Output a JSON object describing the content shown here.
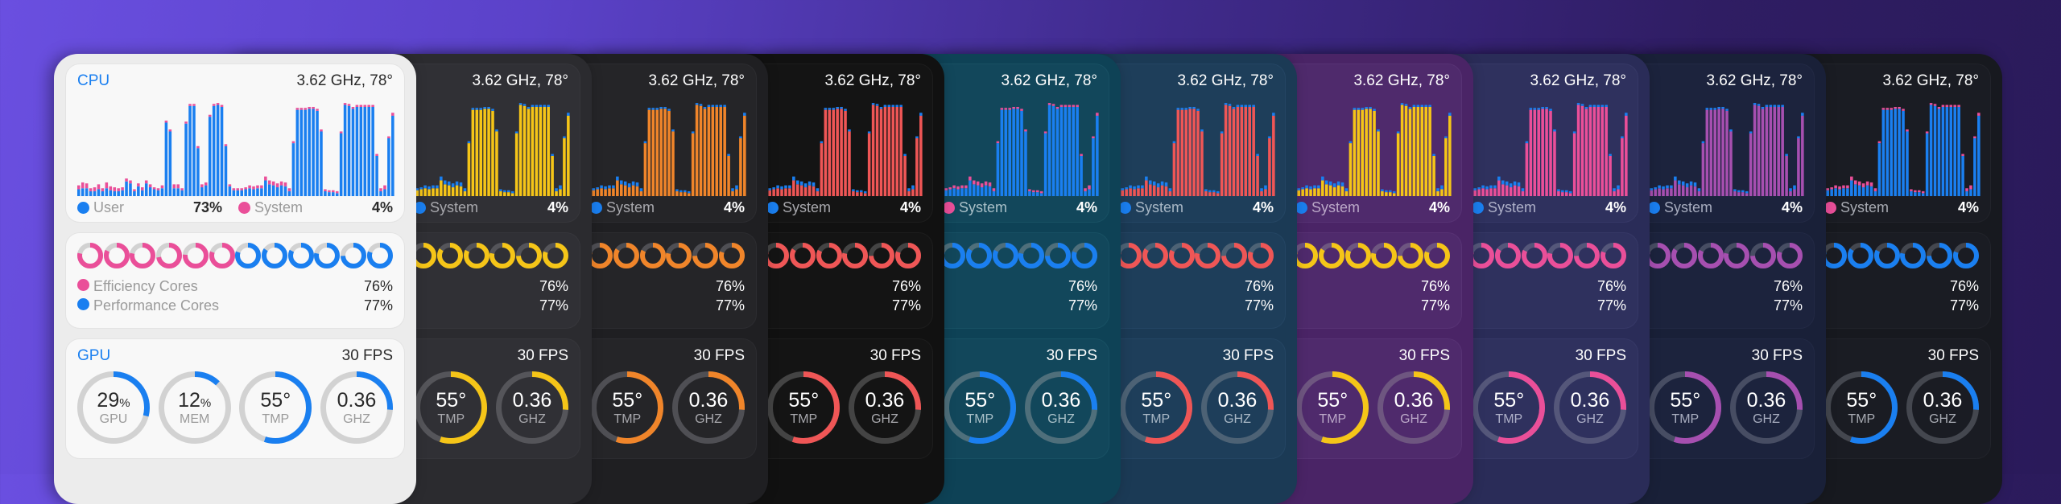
{
  "cpu": {
    "title": "CPU",
    "metric": "3.62 GHz, 78°",
    "user_label": "User",
    "user_value": "73%",
    "system_label": "System",
    "system_value": "4%",
    "user_series": [
      7,
      8,
      8,
      5,
      5,
      7,
      5,
      8,
      6,
      5,
      5,
      6,
      15,
      13,
      5,
      10,
      6,
      13,
      9,
      7,
      6,
      8,
      75,
      66,
      8,
      8,
      6,
      74,
      92,
      92,
      49,
      9,
      11,
      81,
      92,
      93,
      91,
      51,
      10,
      6,
      6,
      6,
      7,
      8,
      7,
      8,
      8,
      16,
      12,
      11,
      9,
      11,
      10,
      5,
      54,
      88,
      88,
      88,
      89,
      89,
      87,
      66,
      5,
      4,
      4,
      3,
      64,
      93,
      92,
      89,
      91,
      91,
      91,
      91,
      91,
      41,
      5,
      7,
      59,
      82
    ],
    "system_series": [
      4,
      6,
      5,
      3,
      4,
      5,
      3,
      6,
      4,
      4,
      3,
      3,
      3,
      3,
      2,
      3,
      3,
      3,
      3,
      2,
      2,
      3,
      2,
      2,
      4,
      4,
      2,
      2,
      2,
      2,
      2,
      3,
      3,
      2,
      2,
      2,
      2,
      2,
      2,
      2,
      2,
      2,
      2,
      3,
      3,
      3,
      3,
      4,
      4,
      4,
      4,
      4,
      4,
      3,
      2,
      2,
      2,
      2,
      2,
      2,
      2,
      2,
      2,
      2,
      2,
      2,
      2,
      2,
      2,
      2,
      2,
      2,
      2,
      2,
      2,
      2,
      3,
      4,
      2,
      3
    ]
  },
  "cores": {
    "efficiency_label": "Efficiency Cores",
    "efficiency_value": "76%",
    "performance_label": "Performance Cores",
    "performance_value": "77%",
    "efficiency_loads": [
      78,
      82,
      78,
      72,
      76,
      80
    ],
    "performance_loads": [
      80,
      84,
      82,
      78,
      74,
      80
    ]
  },
  "gpu": {
    "title": "GPU",
    "fps": "30 FPS",
    "gauges": [
      {
        "value": "29",
        "unit": "%",
        "label": "GPU",
        "fill": 0.29
      },
      {
        "value": "12",
        "unit": "%",
        "label": "MEM",
        "fill": 0.12
      },
      {
        "value": "55°",
        "unit": "",
        "label": "TMP",
        "fill": 0.55
      },
      {
        "value": "0.36",
        "unit": "",
        "label": "GHZ",
        "fill": 0.26
      }
    ]
  },
  "themes": [
    {
      "name": "light",
      "bg": "#ececec",
      "panel": "#f8f8f8",
      "panel_border": "#e3e3e3",
      "text": "#2a2a2a",
      "muted": "#9a9a9a",
      "title": "#1a7ff0",
      "accent": "#1a7ff0",
      "secondary": "#ea4f99",
      "track": "#d2d2d2",
      "cores_split": true
    },
    {
      "name": "graphite-yellow",
      "bg": "#2b2b2f",
      "panel": "#303035",
      "panel_border": "#36363b",
      "text": "#ffffff",
      "muted": "#a8a8ad",
      "title": "#ffffff",
      "accent": "#f5c518",
      "secondary": "#1a7ff0",
      "track": "#55555a",
      "cores_split": false
    },
    {
      "name": "charcoal-orange",
      "bg": "#1f1f22",
      "panel": "#252528",
      "panel_border": "#2c2c30",
      "text": "#ffffff",
      "muted": "#a8a8ad",
      "title": "#ffffff",
      "accent": "#f0852a",
      "secondary": "#1a7ff0",
      "track": "#4f4f54",
      "cores_split": false
    },
    {
      "name": "black-red",
      "bg": "#111111",
      "panel": "#141414",
      "panel_border": "#1d1d1d",
      "text": "#ffffff",
      "muted": "#a8a8ad",
      "title": "#ffffff",
      "accent": "#ef5656",
      "secondary": "#1a7ff0",
      "track": "#444444",
      "cores_split": false
    },
    {
      "name": "teal-blue",
      "bg": "#0e4256",
      "panel": "#12475b",
      "panel_border": "#185063",
      "text": "#ffffff",
      "muted": "#a9c0c8",
      "title": "#ffffff",
      "accent": "#1a7ff0",
      "secondary": "#ea4f99",
      "track": "#4f6f7b",
      "cores_split": false
    },
    {
      "name": "navy-red",
      "bg": "#1b3a55",
      "panel": "#1e3e5a",
      "panel_border": "#244563",
      "text": "#ffffff",
      "muted": "#a9b8c6",
      "title": "#ffffff",
      "accent": "#ef5656",
      "secondary": "#1a7ff0",
      "track": "#4d6275",
      "cores_split": false
    },
    {
      "name": "purple-yellow",
      "bg": "#4a2466",
      "panel": "#4f2a6c",
      "panel_border": "#573274",
      "text": "#ffffff",
      "muted": "#bba8c8",
      "title": "#ffffff",
      "accent": "#f5c518",
      "secondary": "#1a7ff0",
      "track": "#6e5680",
      "cores_split": false
    },
    {
      "name": "indigo-pink",
      "bg": "#2a2c58",
      "panel": "#2f315e",
      "panel_border": "#363866",
      "text": "#ffffff",
      "muted": "#aeb0c8",
      "title": "#ffffff",
      "accent": "#ea4f99",
      "secondary": "#1a7ff0",
      "track": "#55577a",
      "cores_split": false
    },
    {
      "name": "midnight-violet",
      "bg": "#192038",
      "panel": "#1c233d",
      "panel_border": "#222944",
      "text": "#ffffff",
      "muted": "#a8adbf",
      "title": "#ffffff",
      "accent": "#a64fb0",
      "secondary": "#1a7ff0",
      "track": "#474d63",
      "cores_split": false
    },
    {
      "name": "slate-blue",
      "bg": "#17191f",
      "panel": "#1a1c23",
      "panel_border": "#21232a",
      "text": "#ffffff",
      "muted": "#a8abb3",
      "title": "#ffffff",
      "accent": "#1a7ff0",
      "secondary": "#ea4f99",
      "track": "#44474f",
      "cores_split": false
    }
  ]
}
